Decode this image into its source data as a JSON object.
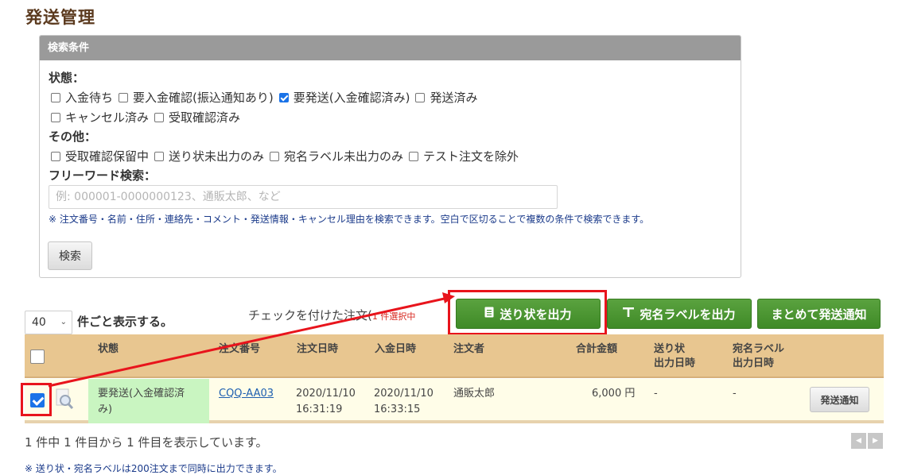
{
  "page": {
    "title": "発送管理"
  },
  "search": {
    "panel_title": "検索条件",
    "status_label": "状態：",
    "status_options": [
      {
        "label": "入金待ち",
        "checked": false
      },
      {
        "label": "要入金確認(振込通知あり)",
        "checked": false
      },
      {
        "label": "要発送(入金確認済み)",
        "checked": true
      },
      {
        "label": "発送済み",
        "checked": false
      },
      {
        "label": "キャンセル済み",
        "checked": false
      },
      {
        "label": "受取確認済み",
        "checked": false
      }
    ],
    "other_label": "その他：",
    "other_options": [
      {
        "label": "受取確認保留中",
        "checked": false
      },
      {
        "label": "送り状未出力のみ",
        "checked": false
      },
      {
        "label": "宛名ラベル未出力のみ",
        "checked": false
      },
      {
        "label": "テスト注文を除外",
        "checked": false
      }
    ],
    "freeword_label": "フリーワード検索：",
    "freeword_placeholder": "例: 000001-0000000123、通販太郎、など",
    "freeword_value": "",
    "hint": "※ 注文番号・名前・住所・連絡先・コメント・発送情報・キャンセル理由を検索できます。空白で区切ることで複数の条件で検索できます。",
    "search_button": "検索"
  },
  "toolbar": {
    "per_page_value": "40",
    "per_page_label": "件ごと表示する。",
    "checked_label": "チェックを付けた注文(",
    "selected_count_text": "1 件選択中",
    "invoice_button": "送り状を出力",
    "label_button": "宛名ラベルを出力",
    "notify_all_button": "まとめて発送通知"
  },
  "table": {
    "headers": {
      "status": "状態",
      "order_no": "注文番号",
      "order_date": "注文日時",
      "paid_date": "入金日時",
      "customer": "注文者",
      "total": "合計金額",
      "invoice_date_1": "送り状",
      "invoice_date_2": "出力日時",
      "label_date_1": "宛名ラベル",
      "label_date_2": "出力日時"
    },
    "rows": [
      {
        "checked": true,
        "status_1": "要発送(入金確認済",
        "status_2": "み)",
        "order_no": "CQQ-AA03",
        "order_date_1": "2020/11/10",
        "order_date_2": "16:31:19",
        "paid_date_1": "2020/11/10",
        "paid_date_2": "16:33:15",
        "customer": "通販太郎",
        "total": "6,000 円",
        "invoice_date": "-",
        "label_date": "-",
        "action": "発送通知"
      }
    ]
  },
  "pagination": {
    "summary": "1 件中 1 件目から 1 件目を表示しています。",
    "prev": "◀",
    "next": "▶"
  },
  "footer_note": "※ 送り状・宛名ラベルは200注文まで同時に出力できます。",
  "colors": {
    "title": "#5b3a1e",
    "green_button": "#4a9630",
    "header_bg": "#e8c690",
    "highlight_red": "#e8141c",
    "status_bg": "#c9f5c1"
  },
  "icons": {
    "invoice": "document-icon",
    "label": "label-icon",
    "detail": "magnifier-icon"
  }
}
